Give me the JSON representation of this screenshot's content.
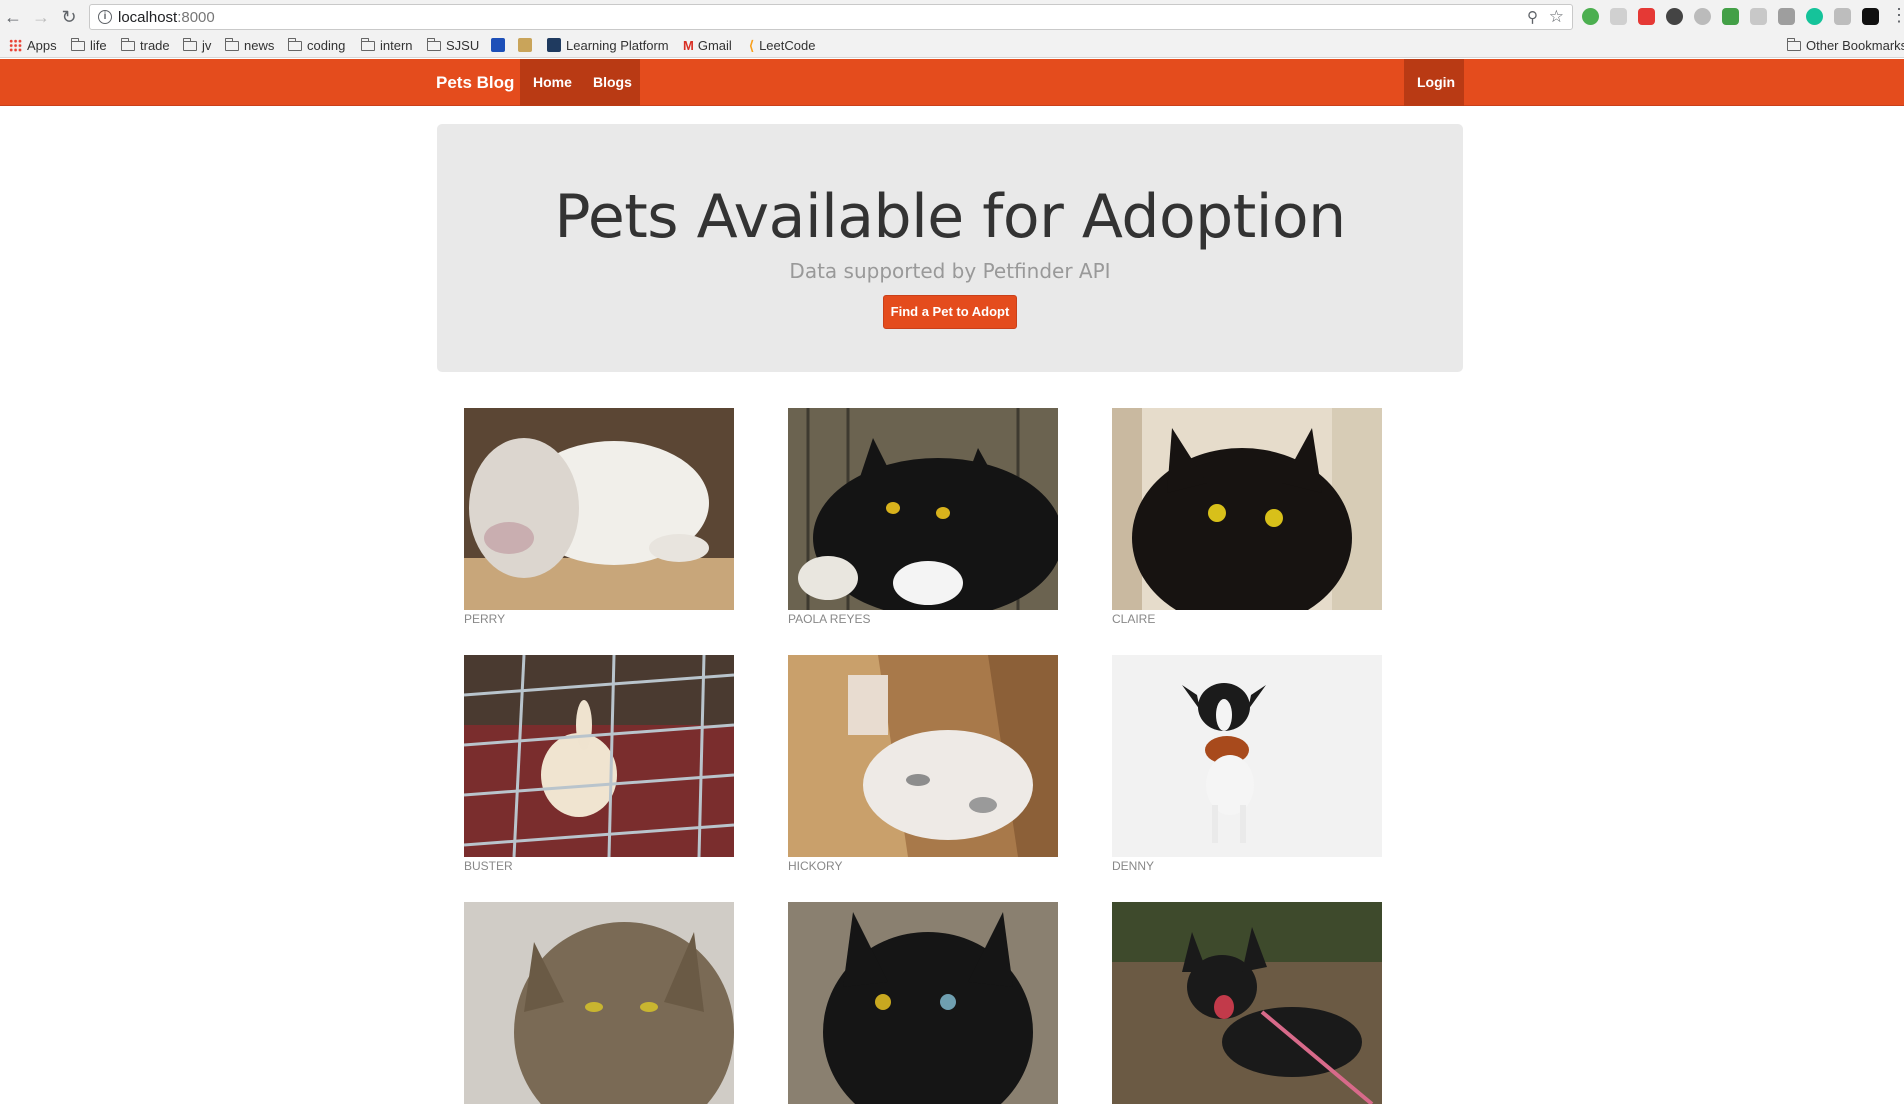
{
  "browser": {
    "url_host": "localhost",
    "url_port": ":8000",
    "bookmarks": [
      "Apps",
      "life",
      "trade",
      "jv",
      "news",
      "coding",
      "intern",
      "SJSU",
      "Learning Platform",
      "Gmail",
      "LeetCode",
      "Other Bookmarks"
    ]
  },
  "navbar": {
    "brand": "Pets Blog",
    "items": [
      "Home",
      "Blogs"
    ],
    "login": "Login"
  },
  "hero": {
    "title": "Pets Available for Adoption",
    "subtitle": "Data supported by Petfinder API",
    "button": "Find a Pet to Adopt"
  },
  "pets": [
    {
      "name": "PERRY"
    },
    {
      "name": "PAOLA REYES"
    },
    {
      "name": "CLAIRE"
    },
    {
      "name": "BUSTER"
    },
    {
      "name": "HICKORY"
    },
    {
      "name": "DENNY"
    },
    {
      "name": ""
    },
    {
      "name": ""
    },
    {
      "name": ""
    }
  ]
}
